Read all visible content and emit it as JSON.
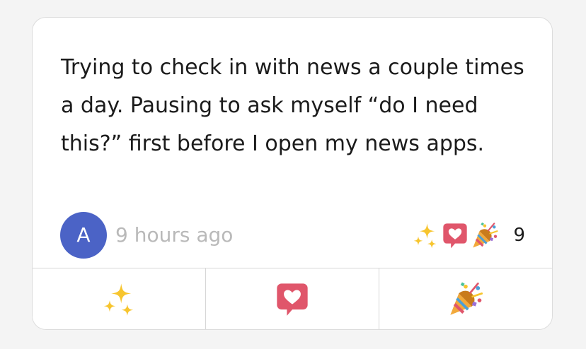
{
  "post": {
    "text": "Trying to check in with news a couple times a day. Pausing to ask myself “do I need this?” first before I open my news apps.",
    "author_initial": "A",
    "timestamp": "9 hours ago",
    "reaction_count": "9"
  },
  "reaction_summary": [
    "sparkles-icon",
    "heart-speech-bubble-icon",
    "party-popper-icon"
  ],
  "reaction_buttons": [
    {
      "icon": "sparkles-icon"
    },
    {
      "icon": "heart-speech-bubble-icon"
    },
    {
      "icon": "party-popper-icon"
    }
  ],
  "colors": {
    "avatar": "#4b63c6",
    "timestamp": "#b9b9b9",
    "sparkles": "#f7c52e",
    "heart_bubble": "#e0566b",
    "popper": "#f2a93b"
  }
}
